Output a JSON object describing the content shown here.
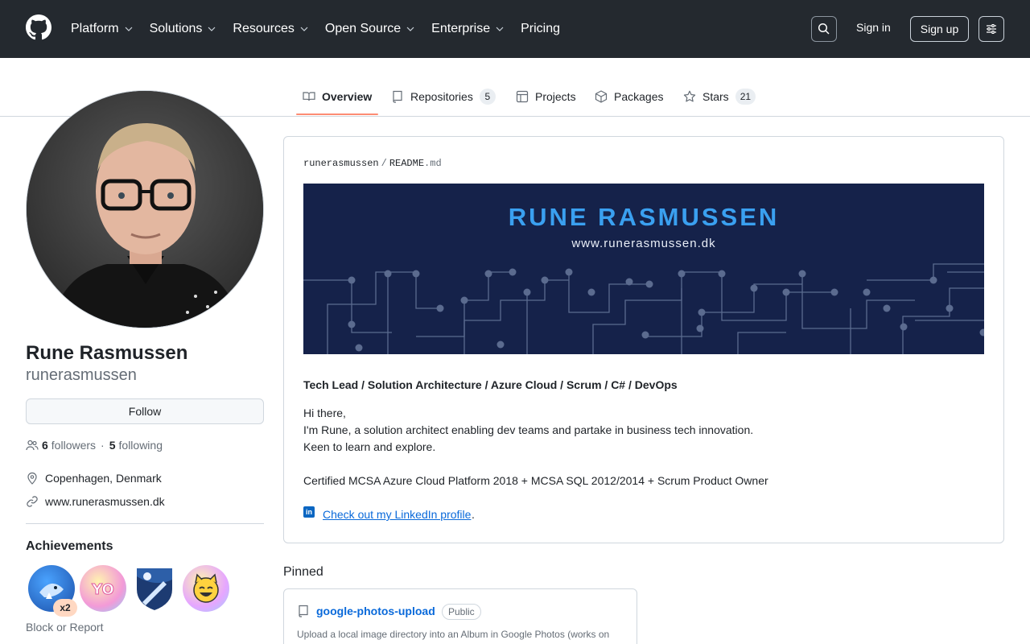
{
  "header": {
    "nav": [
      {
        "label": "Platform",
        "has_menu": true
      },
      {
        "label": "Solutions",
        "has_menu": true
      },
      {
        "label": "Resources",
        "has_menu": true
      },
      {
        "label": "Open Source",
        "has_menu": true
      },
      {
        "label": "Enterprise",
        "has_menu": true
      },
      {
        "label": "Pricing",
        "has_menu": false
      }
    ],
    "signin": "Sign in",
    "signup": "Sign up",
    "icons": {
      "logo": "github-logo",
      "search": "search-icon",
      "settings": "settings-sliders-icon"
    }
  },
  "tabs": [
    {
      "label": "Overview",
      "icon": "book-icon",
      "active": true
    },
    {
      "label": "Repositories",
      "icon": "repo-icon",
      "count": "5"
    },
    {
      "label": "Projects",
      "icon": "table-icon"
    },
    {
      "label": "Packages",
      "icon": "package-icon"
    },
    {
      "label": "Stars",
      "icon": "star-icon",
      "count": "21"
    }
  ],
  "profile": {
    "fullname": "Rune Rasmussen",
    "username": "runerasmussen",
    "follow_label": "Follow",
    "followers_count": "6",
    "followers_label": "followers",
    "following_count": "5",
    "following_label": "following",
    "location": "Copenhagen, Denmark",
    "website": "www.runerasmussen.dk",
    "achievements_title": "Achievements",
    "achievement_multiplier": "x2",
    "block_report": "Block or Report"
  },
  "readme": {
    "path_user": "runerasmussen",
    "path_sep": "/",
    "path_file": "README",
    "path_ext": ".md",
    "banner_title": "RUNE RASMUSSEN",
    "banner_url": "www.runerasmussen.dk",
    "headline": "Tech Lead / Solution Architecture / Azure Cloud / Scrum / C# / DevOps",
    "line1": "Hi there,",
    "line2": "I'm Rune, a solution architect enabling dev teams and partake in business tech innovation.",
    "line3": "Keen to learn and explore.",
    "line4": "Certified MCSA Azure Cloud Platform 2018 + MCSA SQL 2012/2014 + Scrum Product Owner",
    "linkedin_icon_text": "in",
    "linkedin_link": "Check out my LinkedIn profile",
    "linkedin_suffix": "."
  },
  "pinned": {
    "title": "Pinned",
    "repo_name": "google-photos-upload",
    "visibility": "Public",
    "description": "Upload a local image directory into an Album in Google Photos (works on mac/linux/win) C# NET Core"
  },
  "colors": {
    "header_bg": "#24292f",
    "link": "#0969da",
    "tab_underline": "#fd8c73",
    "banner_bg": "#15224a",
    "banner_title": "#3aa0f0"
  }
}
